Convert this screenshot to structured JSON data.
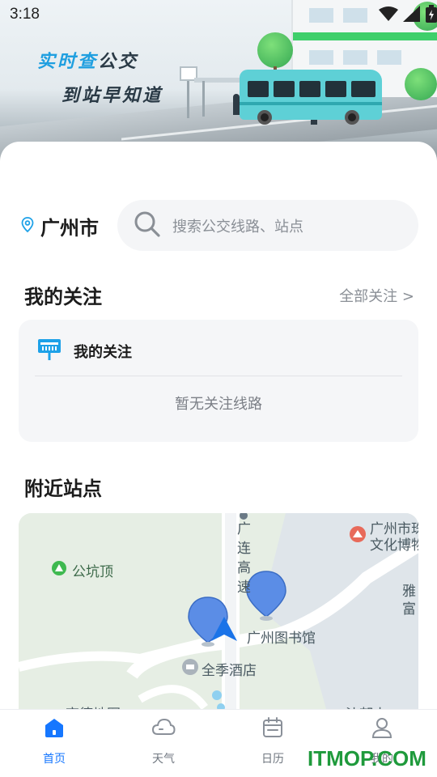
{
  "status_bar": {
    "time": "3:18",
    "icons": [
      "wifi-icon",
      "signal-icon",
      "battery-charging-icon"
    ]
  },
  "banner": {
    "slogan_line1_accent": "实时查",
    "slogan_line1_rest": "公交",
    "slogan_line2": "到站早知道"
  },
  "location": {
    "city": "广州市",
    "icon": "location-pin-icon"
  },
  "search": {
    "placeholder": "搜索公交线路、站点",
    "icon": "search-icon"
  },
  "follow_section": {
    "title": "我的关注",
    "all_link": "全部关注 >",
    "card_title": "我的关注",
    "card_icon": "bus-stop-sign-icon",
    "empty_text": "暂无关注线路"
  },
  "nearby_section": {
    "title": "附近站点",
    "map": {
      "labels": {
        "gongkengding": "公坑顶",
        "road": "广连高速",
        "museum_line1": "广州市珠",
        "museum_line2": "文化博物",
        "library": "广州图书馆",
        "hotel": "全季酒店",
        "ya_fu": "雅\n富",
        "bottom_left": "高德地图",
        "bottom_right": "沙邨小"
      }
    }
  },
  "bottom_nav": {
    "items": [
      {
        "label": "首页",
        "icon": "home-icon",
        "active": true
      },
      {
        "label": "天气",
        "icon": "cloud-icon",
        "active": false
      },
      {
        "label": "日历",
        "icon": "calendar-icon",
        "active": false
      },
      {
        "label": "我的",
        "icon": "user-icon",
        "active": false
      }
    ]
  },
  "watermark": "ITMOP.COM",
  "colors": {
    "accent": "#1677ff",
    "brand_teal": "#5ed0d6",
    "map_bg": "#e8efe6",
    "watermark": "#1f9a3c"
  }
}
